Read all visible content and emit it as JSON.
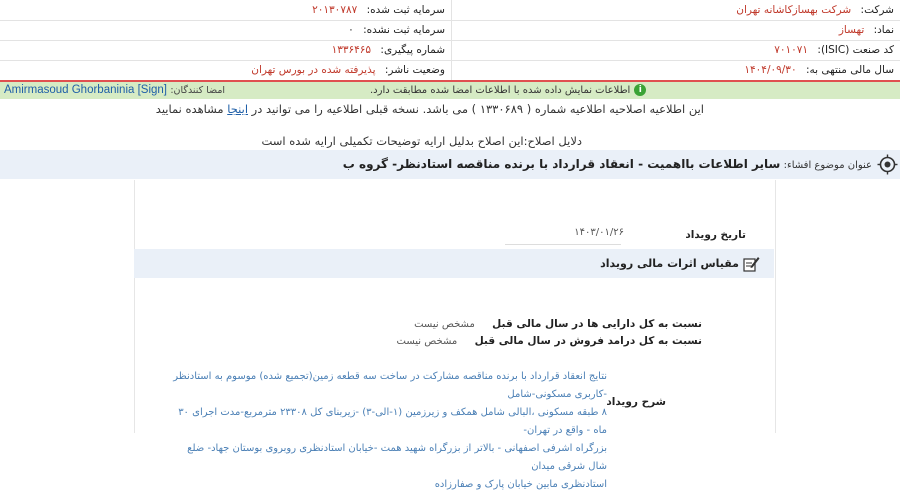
{
  "header": {
    "company_label": "شرکت:",
    "company_value": "شرکت بهسازکاشانه تهران",
    "registered_capital_label": "سرمایه ثبت شده:",
    "registered_capital_value": "۲۰۱۳۰۷۸۷",
    "symbol_label": "نماد:",
    "symbol_value": "تهساز",
    "unregistered_capital_label": "سرمایه ثبت نشده:",
    "unregistered_capital_value": "۰",
    "isic_label": "کد صنعت (ISIC):",
    "isic_value": "۷۰۱۰۷۱",
    "tracking_label": "شماره پیگیری:",
    "tracking_value": "۱۳۳۶۴۶۵",
    "fiscal_year_label": "سال مالی منتهی به:",
    "fiscal_year_value": "۱۴۰۴/۰۹/۳۰",
    "publisher_status_label": "وضعیت ناشر:",
    "publisher_status_value": "پذیرفته شده در بورس تهران"
  },
  "signature_bar": {
    "signers_label": "امضا کنندگان:",
    "signer_name": "Amirmasoud Ghorbaninia [Sign]",
    "verification_text": "اطلاعات نمایش داده شده با اطلاعات امضا شده مطابقت دارد.",
    "colors": {
      "background": "#d6ebc4",
      "accent": "#3aa335",
      "link": "#1f5fa8"
    }
  },
  "notice": {
    "correction_prefix": "این اطلاعیه اصلاحیه اطلاعیه شماره ( ۱۳۳۰۶۸۹ ) می باشد. نسخه قبلی اطلاعیه را می توانید در",
    "link_text": "اینجا",
    "correction_suffix": "مشاهده نمایید",
    "reason": "دلایل اصلاح:این اصلاح بدلیل ارایه توضیحات تکمیلی ارایه شده است"
  },
  "subject": {
    "label": "عنوان موضوع افشاء:",
    "title": "سایر اطلاعات بااهمیت - انعقاد قرارداد با برنده مناقصه استادنظر- گروه ب",
    "icon": "target-icon"
  },
  "event": {
    "date_label": "تاریخ رویداد",
    "date_value": "۱۴۰۳/۰۱/۲۶",
    "compare_title": "مقیاس اثرات مالی رویداد",
    "compare_icon": "edit-icon",
    "assets_ratio_label": "نسبت به کل دارایی ها در سال مالی قبل",
    "assets_ratio_value": "مشخص نیست",
    "sales_ratio_label": "نسبت به کل درامد فروش در سال مالی قبل",
    "sales_ratio_value": "مشخص نیست",
    "description_label": "شرح رویداد",
    "description_lines": [
      "نتایج انعقاد قرارداد با برنده مناقصه مشارکت در ساخت سه قطعه زمین(تجمیع شده) موسوم به استادنظر -کاربری مسکونی-شامل",
      "۸ طبقه مسکونی ،البالی شامل همکف و زیرزمین (۱-الی-۳) -زیربنای کل ۲۳۳۰۸ مترمربع-مدت اجرای ۳۰ ماه - واقع در تهران-",
      "بزرگراه اشرفی اصفهانی - بالاتر از بزرگراه شهید همت -خیابان استادنظری روبروی بوستان جهاد- ضلع شال شرقی میدان",
      "استادنظری مابین خیابان پارک و صفارزاده"
    ]
  }
}
